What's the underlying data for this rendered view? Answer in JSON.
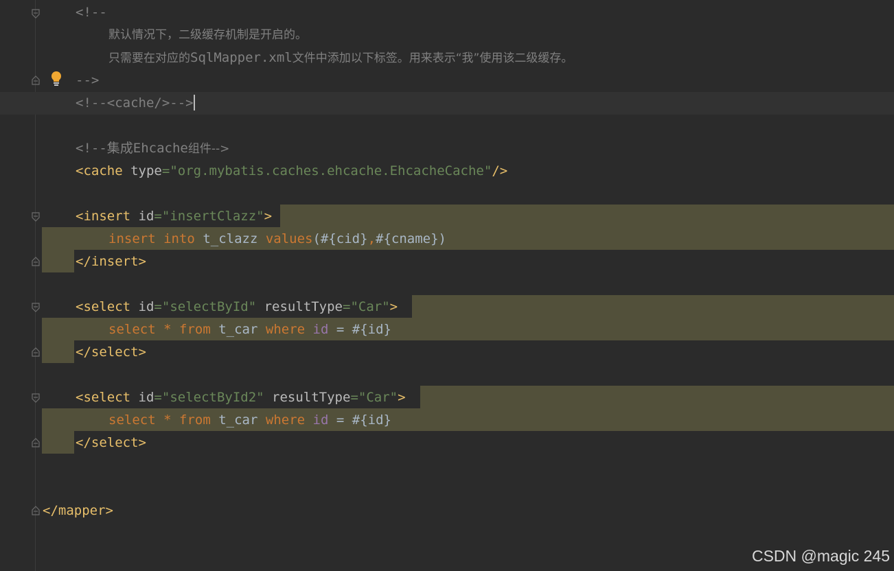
{
  "editor": {
    "comment_open": "<!--",
    "comment_line1": "默认情况下，二级缓存机制是开启的。",
    "comment_line2_a": "只需要在对应的",
    "comment_line2_code": "SqlMapper.xml",
    "comment_line2_b": "文件中添加以下标签。用来表示“我”使用该二级缓存。",
    "comment_close": "-->",
    "cache_comment": "<!--<cache/>-->",
    "ehcache_comment_a": "<!--集成",
    "ehcache_comment_code": "Ehcache",
    "ehcache_comment_b": "组件-->",
    "cache_tag": {
      "open": "<cache",
      "attr": "type",
      "value": "\"org.mybatis.caches.ehcache.EhcacheCache\"",
      "close": "/>"
    },
    "insert": {
      "open": "<insert",
      "attr": "id",
      "value": "\"insertClazz\"",
      "gt": ">",
      "sql_kw1": "insert",
      "sql_kw2": "into",
      "sql_table": "t_clazz",
      "sql_kw3": "values",
      "sql_args": "(#{cid}",
      "sql_comma": ",",
      "sql_args2": "#{cname})",
      "end": "</insert>"
    },
    "select1": {
      "open": "<select",
      "attr1": "id",
      "value1": "\"selectById\"",
      "attr2": "resultType",
      "value2": "\"Car\"",
      "gt": ">",
      "kw_select": "select",
      "star": "*",
      "kw_from": "from",
      "table": "t_car",
      "kw_where": "where",
      "col": "id",
      "eq": "=",
      "param": "#{id}",
      "end": "</select>"
    },
    "select2": {
      "open": "<select",
      "attr1": "id",
      "value1": "\"selectById2\"",
      "attr2": "resultType",
      "value2": "\"Car\"",
      "gt": ">",
      "kw_select": "select",
      "star": "*",
      "kw_from": "from",
      "table": "t_car",
      "kw_where": "where",
      "col": "id",
      "eq": "=",
      "param": "#{id}",
      "end": "</select>"
    },
    "mapper_end": "</mapper>"
  },
  "colors": {
    "background": "#2b2b2b",
    "tag": "#e8bf6a",
    "string": "#6a8759",
    "keyword": "#cc7832",
    "comment": "#808080",
    "highlight": "#52503a"
  },
  "watermark": "CSDN @magic 245"
}
